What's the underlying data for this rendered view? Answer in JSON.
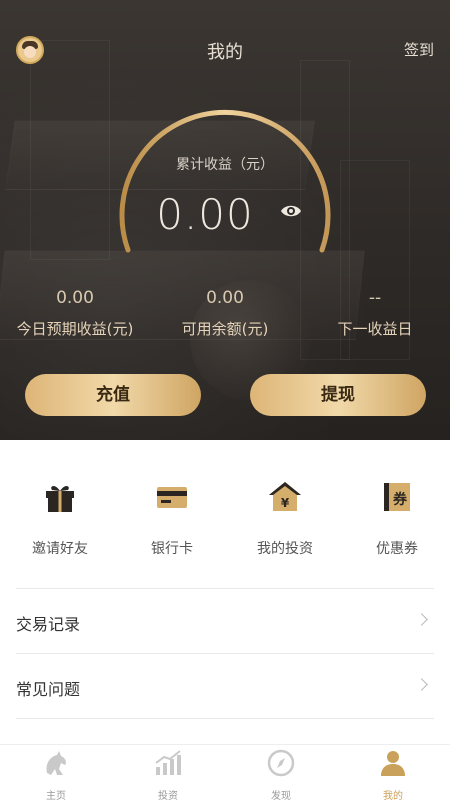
{
  "header": {
    "title": "我的",
    "sign_in": "签到"
  },
  "summary": {
    "total_label": "累计收益（元）",
    "total_value": "0.00"
  },
  "stats": [
    {
      "value": "0.00",
      "label": "今日预期收益(元)"
    },
    {
      "value": "0.00",
      "label": "可用余额(元)"
    },
    {
      "value": "--",
      "label": "下一收益日"
    }
  ],
  "actions": {
    "recharge": "充值",
    "withdraw": "提现"
  },
  "shortcuts": [
    {
      "label": "邀请好友",
      "icon": "gift-icon"
    },
    {
      "label": "银行卡",
      "icon": "bank-card-icon"
    },
    {
      "label": "我的投资",
      "icon": "house-yen-icon"
    },
    {
      "label": "优惠券",
      "icon": "coupon-icon"
    }
  ],
  "menu": [
    {
      "label": "交易记录"
    },
    {
      "label": "常见问题"
    }
  ],
  "tabbar": [
    {
      "label": "主页",
      "icon": "home-horse-icon"
    },
    {
      "label": "投资",
      "icon": "chart-icon"
    },
    {
      "label": "发现",
      "icon": "compass-icon"
    },
    {
      "label": "我的",
      "icon": "user-icon",
      "active": true
    }
  ],
  "colors": {
    "accent_gold": "#d3ac6b",
    "hero_bg": "#2e2a27"
  }
}
